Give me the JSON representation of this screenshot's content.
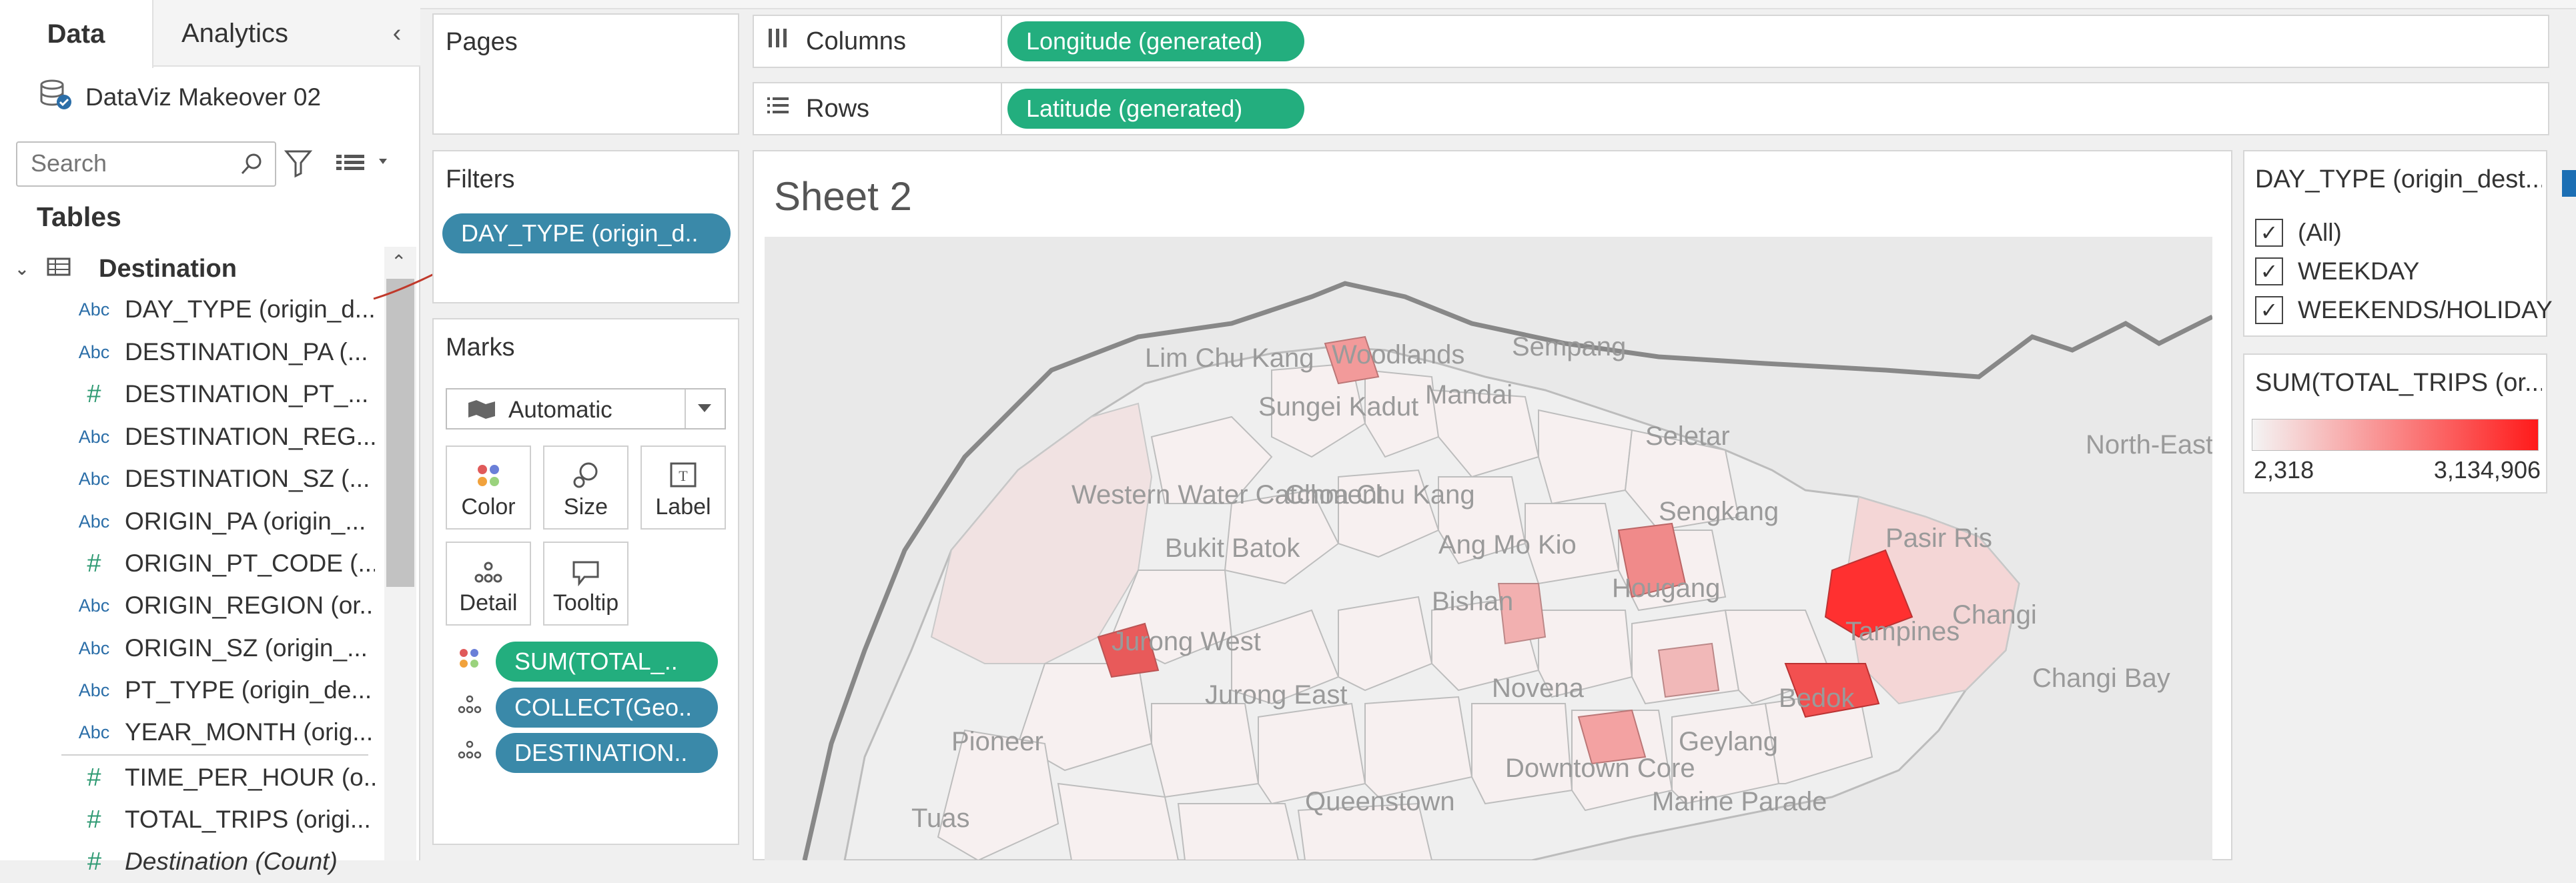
{
  "left_pane": {
    "tabs": [
      {
        "label": "Data"
      },
      {
        "label": "Analytics"
      }
    ],
    "datasource": "DataViz Makeover 02",
    "search_placeholder": "Search",
    "tables_heading": "Tables",
    "table_name": "Destination",
    "fields": [
      {
        "type": "Abc",
        "label": "DAY_TYPE (origin_d..."
      },
      {
        "type": "Abc",
        "label": "DESTINATION_PA (..."
      },
      {
        "type": "#",
        "label": "DESTINATION_PT_..."
      },
      {
        "type": "Abc",
        "label": "DESTINATION_REG..."
      },
      {
        "type": "Abc",
        "label": "DESTINATION_SZ (..."
      },
      {
        "type": "Abc",
        "label": "ORIGIN_PA (origin_..."
      },
      {
        "type": "#",
        "label": "ORIGIN_PT_CODE (..."
      },
      {
        "type": "Abc",
        "label": "ORIGIN_REGION (or..."
      },
      {
        "type": "Abc",
        "label": "ORIGIN_SZ (origin_..."
      },
      {
        "type": "Abc",
        "label": "PT_TYPE (origin_de..."
      },
      {
        "type": "Abc",
        "label": "YEAR_MONTH (orig..."
      },
      {
        "type": "#",
        "label": "TIME_PER_HOUR (o..."
      },
      {
        "type": "#",
        "label": "TOTAL_TRIPS (origi..."
      },
      {
        "type": "#",
        "label": "Destination (Count)"
      }
    ]
  },
  "shelves": {
    "pages_label": "Pages",
    "filters_label": "Filters",
    "filter_pill": "DAY_TYPE (origin_d..",
    "columns_label": "Columns",
    "columns_pill": "Longitude (generated)",
    "rows_label": "Rows",
    "rows_pill": "Latitude (generated)"
  },
  "marks": {
    "title": "Marks",
    "type": "Automatic",
    "buttons": [
      "Color",
      "Size",
      "Label",
      "Detail",
      "Tooltip"
    ],
    "pills": [
      "SUM(TOTAL_..",
      "COLLECT(Geo..",
      "DESTINATION.."
    ]
  },
  "sheet": {
    "title": "Sheet 2",
    "place_labels": [
      "Lim Chu Kang",
      "Woodlands",
      "Sempang",
      "Sungei Kadut",
      "Mandai",
      "Seletar",
      "Western Water Catchment",
      "Choa Chu Kang",
      "Ang Mo Kio",
      "Sengkang",
      "Pasir Ris",
      "North-Eastern Islands",
      "Bukit Batok",
      "Bishan",
      "Hougang",
      "Tampines",
      "Changi",
      "Jurong West",
      "Jurong East",
      "Novena",
      "Geylang",
      "Bedok",
      "Changi Bay",
      "Pioneer",
      "Tuas",
      "Queenstown",
      "Marine Parade",
      "Downtown Core"
    ]
  },
  "legend": {
    "filter_title": "DAY_TYPE (origin_dest...",
    "options": [
      {
        "label": "(All)",
        "checked": true
      },
      {
        "label": "WEEKDAY",
        "checked": true
      },
      {
        "label": "WEEKENDS/HOLIDAY",
        "checked": true
      }
    ],
    "color_title": "SUM(TOTAL_TRIPS (or...",
    "color_min": "2,318",
    "color_max": "3,134,906",
    "color_low": "#f2f2f2",
    "color_high": "#ff1a1a"
  },
  "colors": {
    "pill_green": "#23ae7e",
    "pill_blue": "#3a89a9"
  }
}
